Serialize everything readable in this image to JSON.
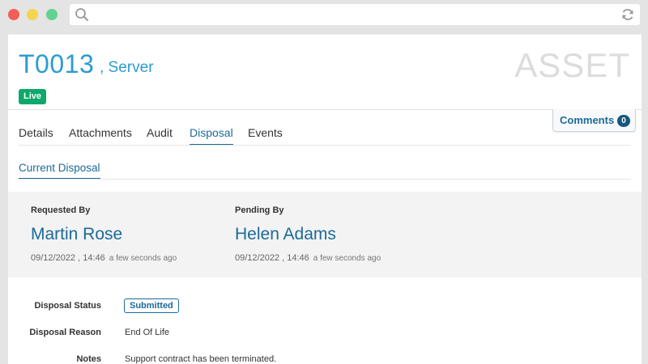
{
  "asset": {
    "id": "T0013",
    "type": " , Server",
    "watermark": "ASSET",
    "status": "Live"
  },
  "comments": {
    "label": "Comments",
    "count": "0"
  },
  "tabs": [
    {
      "label": "Details"
    },
    {
      "label": "Attachments"
    },
    {
      "label": "Audit"
    },
    {
      "label": "Disposal",
      "active": true
    },
    {
      "label": "Events"
    }
  ],
  "subtab": {
    "label": "Current Disposal"
  },
  "requested": {
    "label": "Requested By",
    "name": "Martin Rose",
    "date": "09/12/2022 , 14:46",
    "ago": "a few seconds ago"
  },
  "pending": {
    "label": "Pending By",
    "name": "Helen Adams",
    "date": "09/12/2022 , 14:46",
    "ago": "a few seconds ago"
  },
  "details": {
    "status_label": "Disposal Status",
    "status_value": "Submitted",
    "reason_label": "Disposal Reason",
    "reason_value": "End Of Life",
    "notes_label": "Notes",
    "notes_value": "Support contract has been terminated."
  },
  "colors": {
    "accent": "#1b6a98",
    "title_blue": "#2b9bd1",
    "live_green": "#0ea96a"
  }
}
